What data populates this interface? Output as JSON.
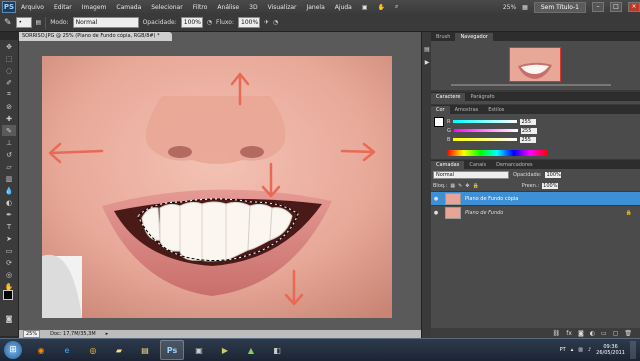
{
  "menubar": {
    "logo": "PS",
    "items": [
      "Arquivo",
      "Editar",
      "Imagem",
      "Camada",
      "Selecionar",
      "Filtro",
      "Análise",
      "3D",
      "Visualizar",
      "Janela",
      "Ajuda"
    ],
    "zoom": "25%",
    "workspace": "Sem Título-1"
  },
  "options": {
    "mode_label": "Modo:",
    "mode_value": "Normal",
    "opacity_label": "Opacidade:",
    "opacity_value": "100%",
    "flow_label": "Fluxo:",
    "flow_value": "100%"
  },
  "document": {
    "tab_title": "SORRISO.JPG @ 25% (Plano de Fundo cópia, RGB/8#) *",
    "status_zoom": "25%",
    "status_doc": "Doc: 17,7M/35,3M"
  },
  "panels": {
    "navigator_tabs": [
      "Brush",
      "Navegador"
    ],
    "char_tabs": [
      "Caractere",
      "Parágrafo"
    ],
    "color_tabs": [
      "Cor",
      "Amostras",
      "Estilos"
    ],
    "color": {
      "r_label": "R",
      "r_value": "255",
      "g_label": "G",
      "g_value": "255",
      "b_label": "B",
      "b_value": "255"
    },
    "layers_tabs": [
      "Camadas",
      "Canais",
      "Demarcadores"
    ],
    "blend_mode": "Normal",
    "opacity_label": "Opacidade:",
    "opacity_value": "100%",
    "lock_label": "Bloq.:",
    "fill_label": "Preen.:",
    "fill_value": "100%",
    "layers": [
      {
        "name": "Plano de Fundo cópia",
        "selected": true
      },
      {
        "name": "Plano de Fundo",
        "selected": false
      }
    ]
  },
  "taskbar": {
    "language": "PT",
    "time": "09:36",
    "date": "26/05/2011"
  },
  "colors": {
    "selection_blue": "#3d8fd6",
    "arrow": "#e86a56"
  }
}
